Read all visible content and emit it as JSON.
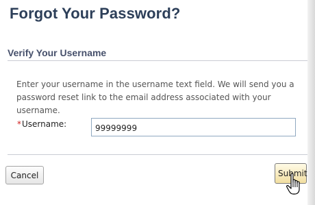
{
  "dialog": {
    "title": "Forgot Your Password?",
    "section_heading": "Verify Your Username",
    "instructions": "Enter your username in the username text field. We will send you a password reset link to the email address associated with your username.",
    "username_field": {
      "required_marker": "*",
      "label": "Username:",
      "value": "99999999"
    },
    "buttons": {
      "cancel_label": "Cancel",
      "submit_label": "Submit"
    }
  },
  "colors": {
    "title": "#2d3f59",
    "heading": "#46506b",
    "required": "#d0201f",
    "submit_bg": "#f2dfa0"
  },
  "icons": {
    "cursor": "hand-pointer-icon"
  }
}
